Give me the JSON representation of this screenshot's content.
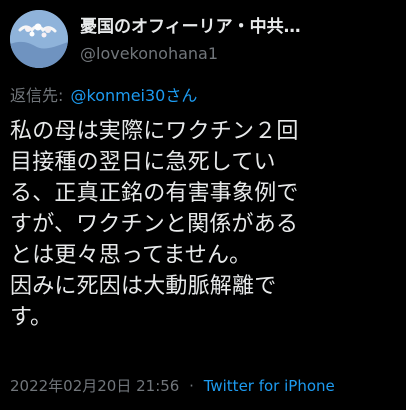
{
  "user": {
    "display_name": "憂国のオフィーリア・中共…",
    "handle": "@lovekonohana1",
    "avatar_icon": "avatar-icon"
  },
  "reply": {
    "label": "返信先:",
    "target": "@konmei30さん"
  },
  "tweet": {
    "lines": [
      "私の母は実際にワクチン２回",
      "目接種の翌日に急死してい",
      "る、正真正銘の有害事象例で",
      "すが、ワクチンと関係がある",
      "とは更々思ってません。",
      "因みに死因は大動脈解離で",
      "す。"
    ]
  },
  "meta": {
    "date": "2022年02月20日 21:56",
    "separator": "·",
    "source": "Twitter for iPhone"
  },
  "colors": {
    "background": "#000000",
    "text": "#e7e9ea",
    "secondary": "#71767b",
    "link": "#1d9bf0"
  }
}
